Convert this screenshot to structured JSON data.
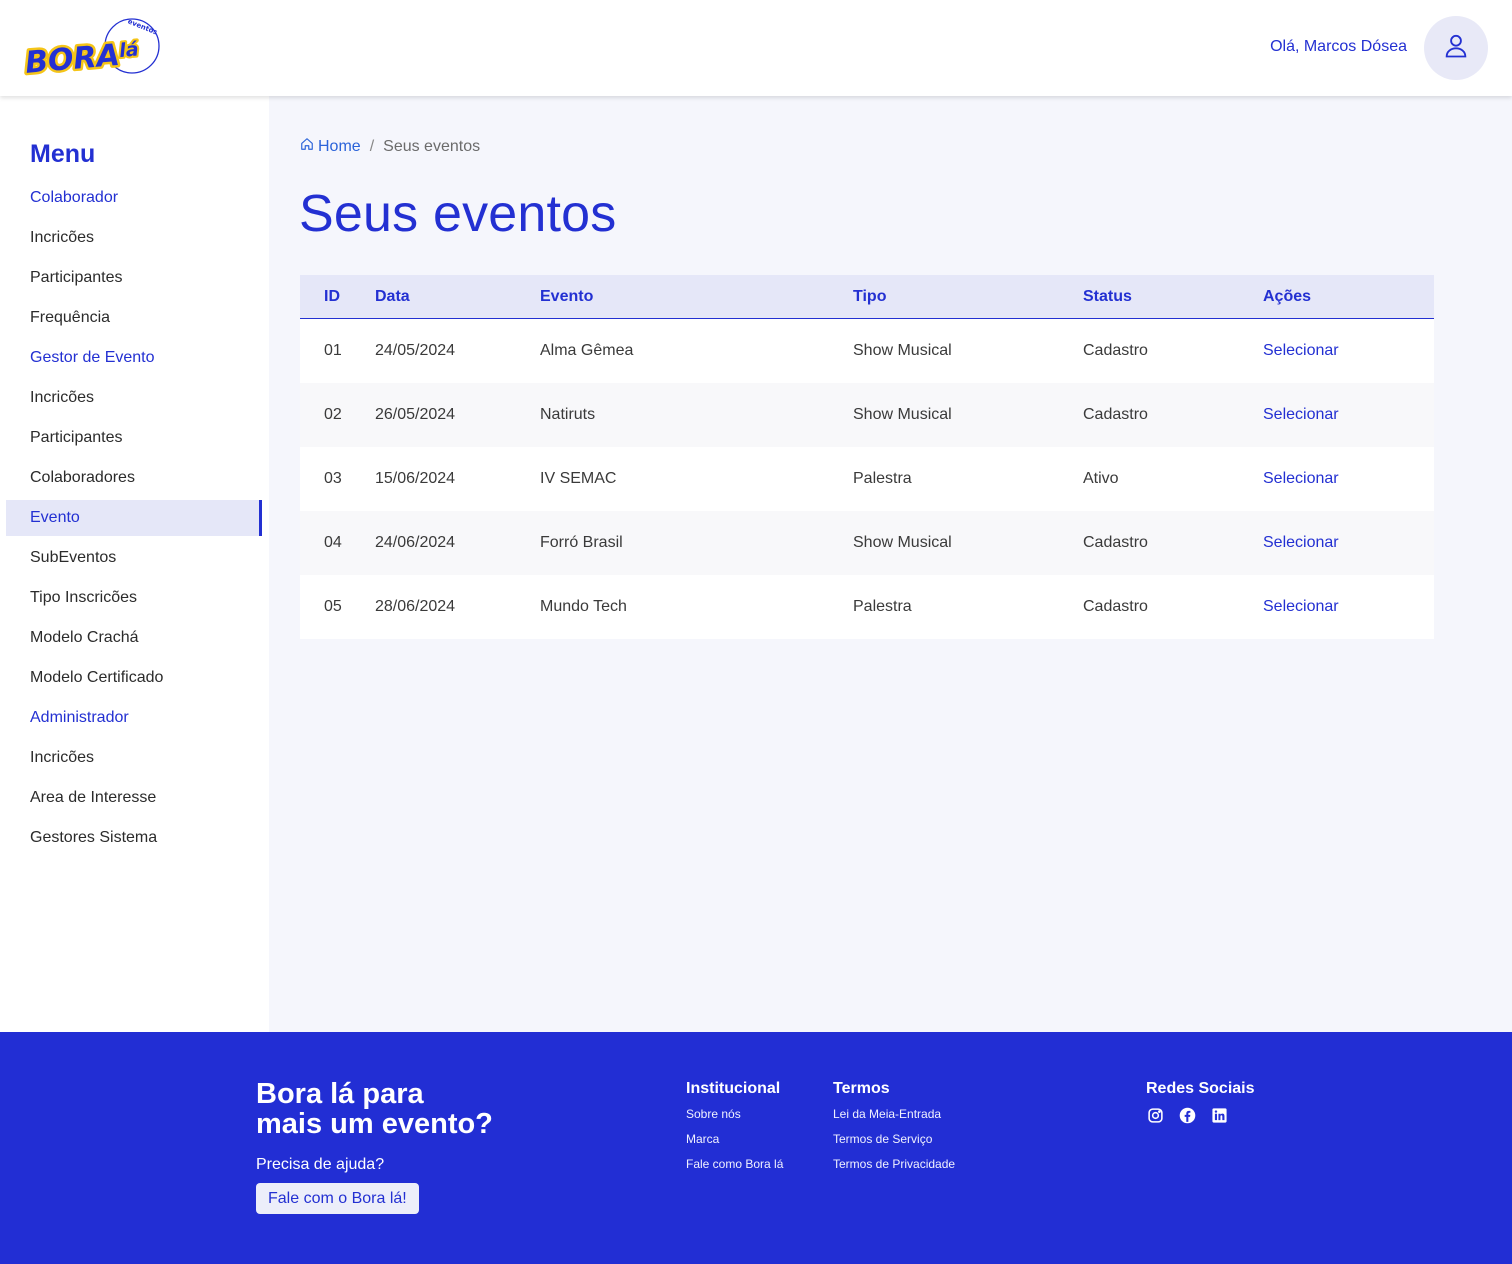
{
  "header": {
    "logo_text": "BORA lá",
    "logo_sub": "eventos",
    "greeting": "Olá, Marcos Dósea"
  },
  "sidebar": {
    "title": "Menu",
    "items": [
      {
        "label": "Colaborador",
        "type": "section"
      },
      {
        "label": "Incricões",
        "type": "item"
      },
      {
        "label": "Participantes",
        "type": "item"
      },
      {
        "label": "Frequência",
        "type": "item"
      },
      {
        "label": "Gestor de Evento",
        "type": "section"
      },
      {
        "label": "Incricões",
        "type": "item"
      },
      {
        "label": "Participantes",
        "type": "item"
      },
      {
        "label": "Colaboradores",
        "type": "item"
      },
      {
        "label": "Evento",
        "type": "active"
      },
      {
        "label": "SubEventos",
        "type": "item"
      },
      {
        "label": "Tipo Inscricões",
        "type": "item"
      },
      {
        "label": "Modelo Crachá",
        "type": "item"
      },
      {
        "label": "Modelo Certificado",
        "type": "item"
      },
      {
        "label": "Administrador",
        "type": "section"
      },
      {
        "label": "Incricões",
        "type": "item"
      },
      {
        "label": "Area de Interesse",
        "type": "item"
      },
      {
        "label": "Gestores Sistema",
        "type": "item"
      }
    ]
  },
  "breadcrumb": {
    "home": "Home",
    "separator": "/",
    "current": "Seus eventos"
  },
  "page": {
    "title": "Seus eventos"
  },
  "table": {
    "headers": [
      "ID",
      "Data",
      "Evento",
      "Tipo",
      "Status",
      "Ações"
    ],
    "rows": [
      {
        "id": "01",
        "date": "24/05/2024",
        "event": "Alma Gêmea",
        "type": "Show Musical",
        "status": "Cadastro",
        "action": "Selecionar"
      },
      {
        "id": "02",
        "date": "26/05/2024",
        "event": "Natiruts",
        "type": "Show Musical",
        "status": "Cadastro",
        "action": "Selecionar"
      },
      {
        "id": "03",
        "date": "15/06/2024",
        "event": "IV SEMAC",
        "type": "Palestra",
        "status": "Ativo",
        "action": "Selecionar"
      },
      {
        "id": "04",
        "date": "24/06/2024",
        "event": "Forró Brasil",
        "type": "Show Musical",
        "status": "Cadastro",
        "action": "Selecionar"
      },
      {
        "id": "05",
        "date": "28/06/2024",
        "event": "Mundo Tech",
        "type": "Palestra",
        "status": "Cadastro",
        "action": "Selecionar"
      }
    ]
  },
  "footer": {
    "tagline_line1": "Bora lá para",
    "tagline_line2": "mais um evento?",
    "help_text": "Precisa de ajuda?",
    "help_button": "Fale com o Bora lá!",
    "institucional": {
      "title": "Institucional",
      "links": [
        "Sobre nós",
        "Marca",
        "Fale como Bora lá"
      ]
    },
    "termos": {
      "title": "Termos",
      "links": [
        "Lei da Meia-Entrada",
        "Termos de Serviço",
        "Termos de Privacidade"
      ]
    },
    "social": {
      "title": "Redes Sociais",
      "icons": [
        "instagram-icon",
        "facebook-icon",
        "linkedin-icon"
      ]
    }
  },
  "colors": {
    "primary": "#2330d2",
    "logo_yellow": "#f5c518",
    "page_bg": "#f5f6fc",
    "header_row_bg": "#e5e7f8"
  }
}
